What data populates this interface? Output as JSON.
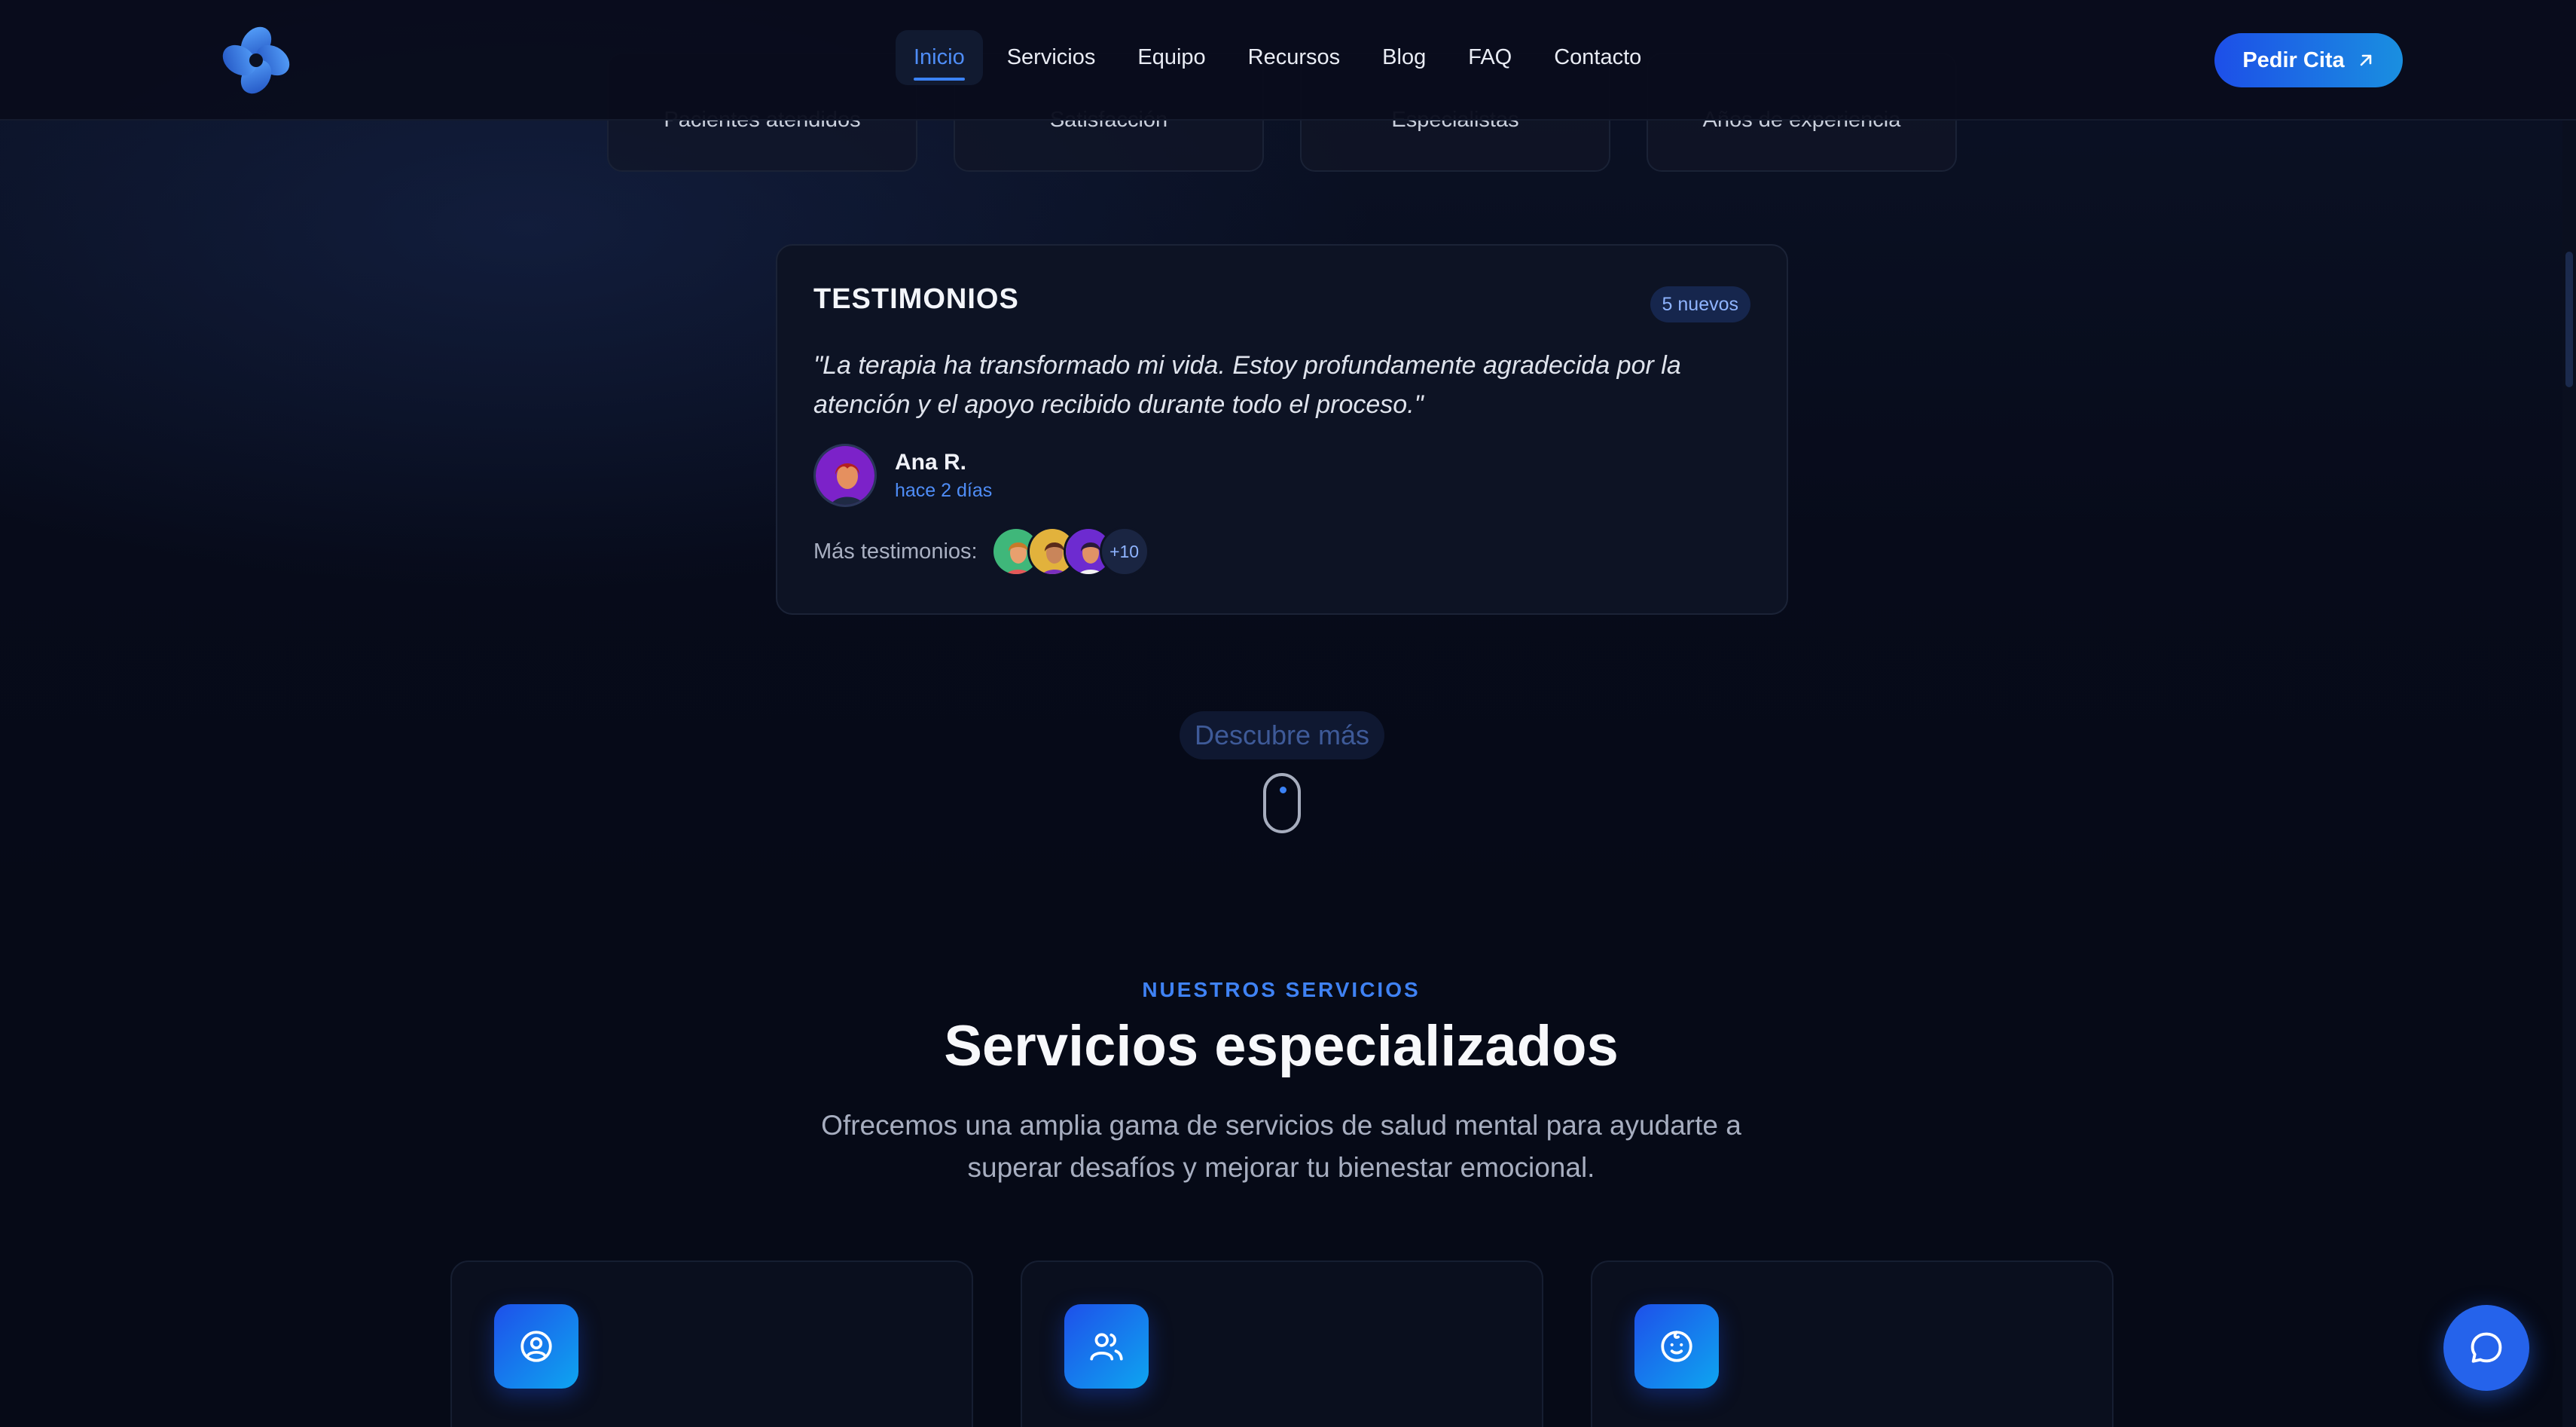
{
  "header": {
    "nav": [
      {
        "label": "Inicio",
        "active": true
      },
      {
        "label": "Servicios"
      },
      {
        "label": "Equipo"
      },
      {
        "label": "Recursos"
      },
      {
        "label": "Blog"
      },
      {
        "label": "FAQ"
      },
      {
        "label": "Contacto"
      }
    ],
    "cta_label": "Pedir Cita",
    "cta_icon": "arrow-up-right-icon"
  },
  "stats": [
    {
      "label": "Pacientes atendidos"
    },
    {
      "label": "Satisfacción"
    },
    {
      "label": "Especialistas"
    },
    {
      "label": "Años de experiencia"
    }
  ],
  "testimonials": {
    "title": "TESTIMONIOS",
    "badge": "5 nuevos",
    "quote": "\"La terapia ha transformado mi vida. Estoy profundamente agradecida por la atención y el apoyo recibido durante todo el proceso.\"",
    "author": "Ana R.",
    "time": "hace 2 días",
    "more_label": "Más testimonios:",
    "more_count": "+10"
  },
  "discover": {
    "label": "Descubre más"
  },
  "services": {
    "eyebrow": "NUESTROS SERVICIOS",
    "title": "Servicios especializados",
    "description": "Ofrecemos una amplia gama de servicios de salud mental para ayudarte a superar desafíos y mejorar tu bienestar emocional.",
    "cards": [
      {
        "icon": "user-circle-icon"
      },
      {
        "icon": "users-icon"
      },
      {
        "icon": "baby-face-icon"
      }
    ]
  },
  "colors": {
    "accent": "#3b82f6",
    "background": "#060a17",
    "card": "#0d1324"
  }
}
